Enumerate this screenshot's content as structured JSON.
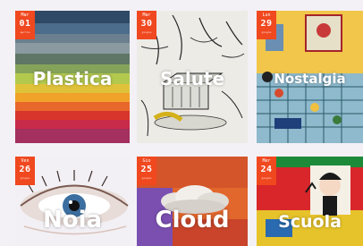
{
  "cards": [
    {
      "title": "Plastica",
      "badge": {
        "day": "Mar",
        "num": "01",
        "month": "aprile"
      }
    },
    {
      "title": "Salute",
      "badge": {
        "day": "Mar",
        "num": "30",
        "month": "giugno"
      }
    },
    {
      "title": "Nostalgia",
      "badge": {
        "day": "Lun",
        "num": "29",
        "month": "giugno"
      }
    },
    {
      "title": "Noia",
      "badge": {
        "day": "Ven",
        "num": "26",
        "month": "giugno"
      }
    },
    {
      "title": "Cloud",
      "badge": {
        "day": "Gio",
        "num": "25",
        "month": "giugno"
      }
    },
    {
      "title": "Scuola",
      "badge": {
        "day": "Mer",
        "num": "24",
        "month": "giugno"
      }
    }
  ],
  "colors": {
    "badge": "#f0481f",
    "page_bg": "#f3f1f6"
  }
}
